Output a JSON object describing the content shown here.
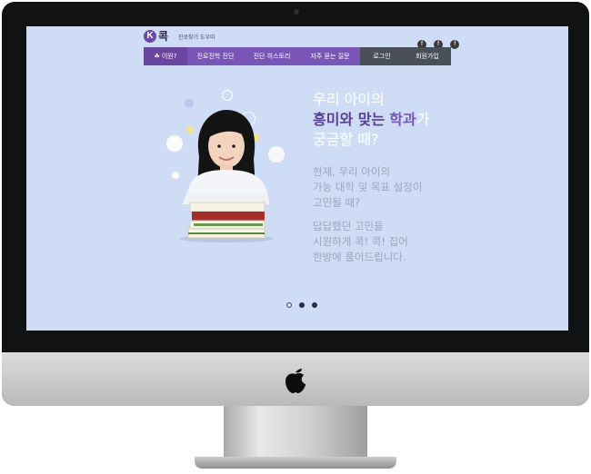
{
  "header": {
    "logo_badge": "K",
    "logo_text": "콕",
    "tagline": "진로찾기 도우미"
  },
  "social": [
    "f",
    "f",
    "f"
  ],
  "nav": {
    "items": [
      {
        "label": "이원?",
        "icon": "leaf-icon"
      },
      {
        "label": "진로진학 진단"
      },
      {
        "label": "진단 히스토리"
      },
      {
        "label": "자주 묻는 질문"
      },
      {
        "label": "로그인"
      },
      {
        "label": "회원가입"
      }
    ]
  },
  "hero": {
    "line1": "우리 아이의",
    "line2_bold": "흥미와 맞는",
    "line2_accent": "학과",
    "line2_end": "가",
    "line3": "궁금할 때?",
    "para1": [
      "현재, 우리 아이의",
      "가능 대학 및 목표 설정이",
      "고민될 때?"
    ],
    "para2": [
      "답답했던 고민들",
      "시원하게 콕! 콕! 집어",
      "한방에 풀어드립니다."
    ]
  },
  "slider": {
    "count": 3,
    "active": 1
  },
  "colors": {
    "screen_bg": "#cfdcf5",
    "nav_purple": "#7a55b8",
    "nav_dark": "#4a5058",
    "brand": "#6b4aa5"
  }
}
